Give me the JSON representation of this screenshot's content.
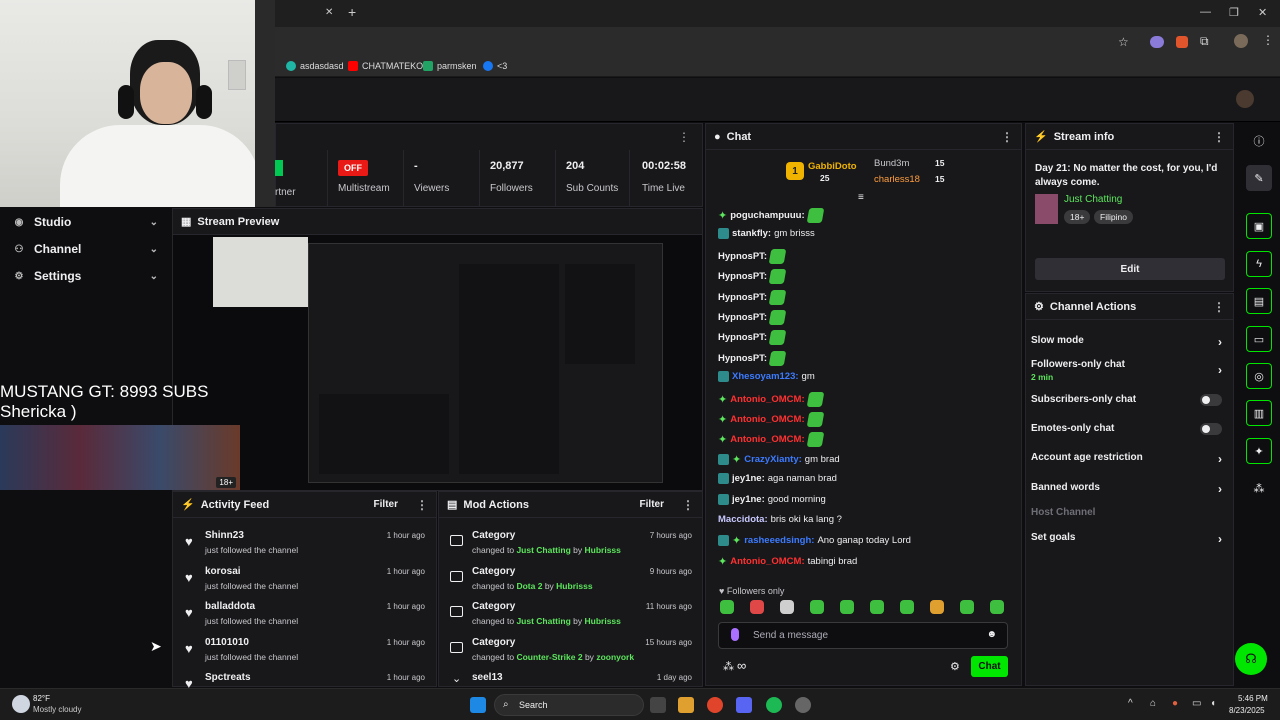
{
  "browser": {
    "tab_close": "✕",
    "new_tab": "+",
    "bookmarks": [
      {
        "label": "asdasdasd",
        "color": "#1fb6a6"
      },
      {
        "label": "CHATMATEKO",
        "color": "#ff0000"
      },
      {
        "label": "parmsken",
        "color": "#21a366"
      },
      {
        "label": "<3",
        "color": "#1877f2"
      }
    ]
  },
  "nav": {
    "items": [
      {
        "label": "Studio"
      },
      {
        "label": "Channel"
      },
      {
        "label": "Settings"
      }
    ]
  },
  "overlay": {
    "line1": "MUSTANG GT: 8993 SUBS",
    "line2": "Shericka )",
    "badge": "18+"
  },
  "stats": {
    "partner_label": "rtner",
    "multistream_value": "OFF",
    "multistream_label": "Multistream",
    "viewers_value": "-",
    "viewers_label": "Viewers",
    "followers_value": "20,877",
    "followers_label": "Followers",
    "subs_value": "204",
    "subs_label": "Sub Counts",
    "time_value": "00:02:58",
    "time_label": "Time Live"
  },
  "preview": {
    "title": "Stream Preview"
  },
  "chat": {
    "title": "Chat",
    "leaders": [
      {
        "name": "GabbiDoto",
        "count": "25"
      },
      {
        "name": "Bund3m",
        "count": "15"
      },
      {
        "name": "charless18",
        "count": "15"
      }
    ],
    "messages": [
      {
        "user": "poguchampuuu:",
        "text": "",
        "color": "#efeff1",
        "emote": true
      },
      {
        "user": "stankfly:",
        "text": "gm brisss",
        "color": "#efeff1",
        "emote": false
      },
      {
        "user": "HypnosPT:",
        "text": "",
        "color": "#efeff1",
        "emote": true
      },
      {
        "user": "HypnosPT:",
        "text": "",
        "color": "#efeff1",
        "emote": true
      },
      {
        "user": "HypnosPT:",
        "text": "",
        "color": "#efeff1",
        "emote": true
      },
      {
        "user": "HypnosPT:",
        "text": "",
        "color": "#efeff1",
        "emote": true
      },
      {
        "user": "HypnosPT:",
        "text": "",
        "color": "#efeff1",
        "emote": true
      },
      {
        "user": "HypnosPT:",
        "text": "",
        "color": "#efeff1",
        "emote": true
      },
      {
        "user": "Xhesoyam123:",
        "text": "gm",
        "color": "#3c7bff",
        "emote": false
      },
      {
        "user": "Antonio_OMCM:",
        "text": "",
        "color": "#ff3030",
        "emote": true
      },
      {
        "user": "Antonio_OMCM:",
        "text": "",
        "color": "#ff3030",
        "emote": true
      },
      {
        "user": "Antonio_OMCM:",
        "text": "",
        "color": "#ff3030",
        "emote": true
      },
      {
        "user": "CrazyXianty:",
        "text": "gm brad",
        "color": "#3c7bff",
        "emote": false
      },
      {
        "user": "jey1ne:",
        "text": "aga naman brad",
        "color": "#efeff1",
        "emote": false
      },
      {
        "user": "jey1ne:",
        "text": "good morning",
        "color": "#efeff1",
        "emote": false
      },
      {
        "user": "Maccidota:",
        "text": "bris oki ka lang ?",
        "color": "#c8c8ff",
        "emote": false
      },
      {
        "user": "rasheeedsingh:",
        "text": "Ano ganap today Lord",
        "color": "#3c7bff",
        "emote": false
      },
      {
        "user": "Antonio_OMCM:",
        "text": "tabingi brad",
        "color": "#ff3030",
        "emote": false
      }
    ],
    "followers_only": "Followers only",
    "placeholder": "Send a message",
    "chat_button": "Chat",
    "infinity": "∞"
  },
  "stream_info": {
    "title": "Stream info",
    "description": "Day 21: No matter the cost, for you, I'd always come.",
    "category": "Just Chatting",
    "tags": [
      "18+",
      "Filipino"
    ],
    "edit_label": "Edit"
  },
  "channel_actions": {
    "title": "Channel Actions",
    "items": [
      {
        "label": "Slow mode"
      },
      {
        "label": "Followers-only chat",
        "sub": "2 min"
      },
      {
        "label": "Subscribers-only chat"
      },
      {
        "label": "Emotes-only chat"
      },
      {
        "label": "Account age restriction"
      },
      {
        "label": "Banned words"
      },
      {
        "label": "Host Channel"
      },
      {
        "label": "Set goals"
      }
    ]
  },
  "activity_feed": {
    "title": "Activity Feed",
    "filter": "Filter",
    "items": [
      {
        "name": "Shinn23",
        "action": "just followed the channel",
        "time": "1 hour ago"
      },
      {
        "name": "korosai",
        "action": "just followed the channel",
        "time": "1 hour ago"
      },
      {
        "name": "balladdota",
        "action": "just followed the channel",
        "time": "1 hour ago"
      },
      {
        "name": "01101010",
        "action": "just followed the channel",
        "time": "1 hour ago"
      },
      {
        "name": "Spctreats",
        "action": "",
        "time": "1 hour ago"
      }
    ]
  },
  "mod_actions": {
    "title": "Mod Actions",
    "filter": "Filter",
    "items": [
      {
        "name": "Category",
        "prefix": "changed to",
        "value": "Just Chatting",
        "by": "by",
        "mod": "Hubrisss",
        "time": "7 hours ago"
      },
      {
        "name": "Category",
        "prefix": "changed to",
        "value": "Dota 2",
        "by": "by",
        "mod": "Hubrisss",
        "time": "9 hours ago"
      },
      {
        "name": "Category",
        "prefix": "changed to",
        "value": "Just Chatting",
        "by": "by",
        "mod": "Hubrisss",
        "time": "11 hours ago"
      },
      {
        "name": "Category",
        "prefix": "changed to",
        "value": "Counter-Strike 2",
        "by": "by",
        "mod": "zoonyork",
        "time": "15 hours ago"
      },
      {
        "name": "seel13",
        "prefix": "",
        "value": "",
        "by": "",
        "mod": "",
        "time": "1 day ago"
      }
    ]
  },
  "taskbar": {
    "temp": "82°F",
    "weather": "Mostly cloudy",
    "search": "Search",
    "time": "5:46 PM",
    "date": "8/23/2025"
  }
}
